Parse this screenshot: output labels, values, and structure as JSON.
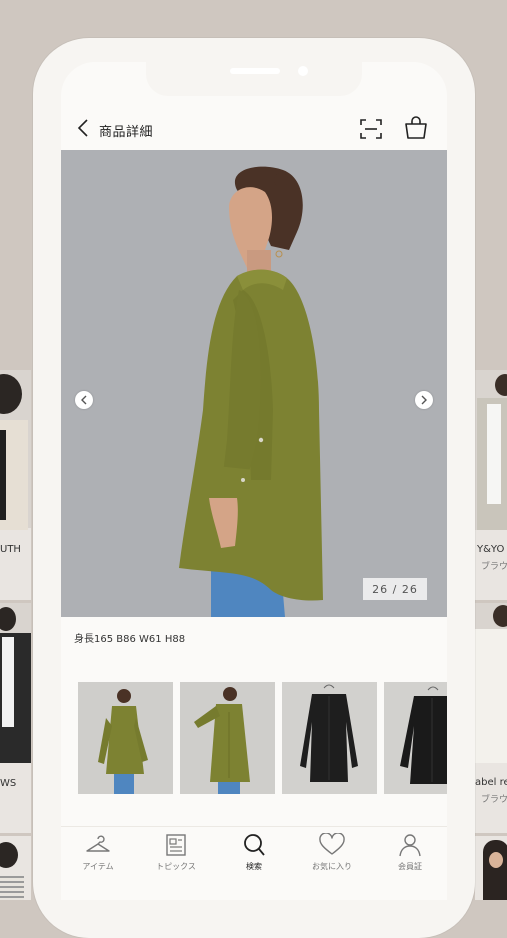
{
  "header": {
    "title": "商品詳細"
  },
  "product": {
    "image_counter": "26 / 26",
    "model_size": "身長165 B86 W61 H88"
  },
  "tabs": [
    {
      "label": "アイテム",
      "icon": "hanger-icon"
    },
    {
      "label": "トピックス",
      "icon": "news-icon"
    },
    {
      "label": "検索",
      "icon": "search-icon",
      "active": true
    },
    {
      "label": "お気に入り",
      "icon": "heart-icon"
    },
    {
      "label": "会員証",
      "icon": "person-icon"
    }
  ],
  "background": {
    "left_cards": [
      "UTH",
      "WS"
    ],
    "right_cards": [
      {
        "label": "Y&YO",
        "sub": "ブラウ"
      },
      {
        "label": "abel rel",
        "sub": "ブラウ"
      }
    ]
  },
  "colors": {
    "background": "#cfc7c0",
    "phone_frame": "#f7f5f2",
    "photo_backdrop": "#aeb0b4",
    "shirt_olive": "#7d8232",
    "jeans_blue": "#4f86c0"
  }
}
